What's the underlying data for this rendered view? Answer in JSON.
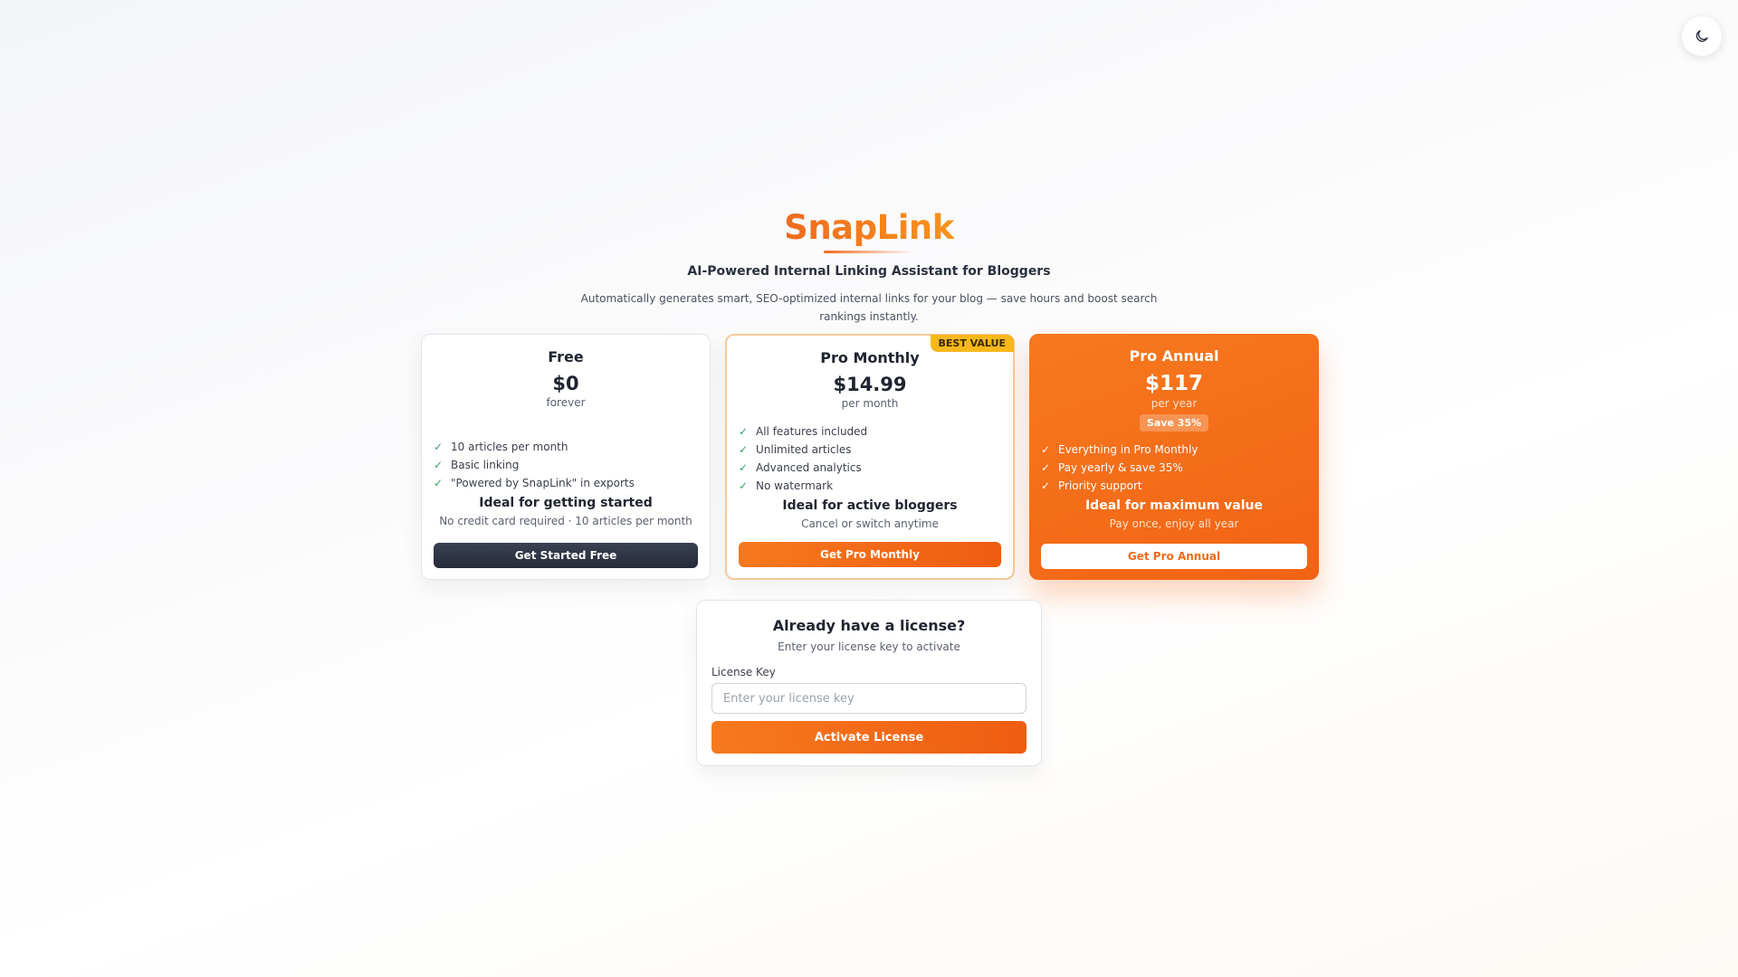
{
  "header": {
    "theme_toggle_icon": "moon-icon"
  },
  "hero": {
    "brand": "SnapLink",
    "tagline": "AI-Powered Internal Linking Assistant for Bloggers",
    "description": "Automatically generates smart, SEO-optimized internal links for your blog — save hours and boost search rankings instantly."
  },
  "plans": {
    "free": {
      "name": "Free",
      "price": "$0",
      "period": "forever",
      "features": [
        "10 articles per month",
        "Basic linking",
        "\"Powered by SnapLink\" in exports"
      ],
      "ideal": "Ideal for getting started",
      "sub": "No credit card required · 10 articles per month",
      "button": "Get Started Free"
    },
    "monthly": {
      "badge": "BEST VALUE",
      "name": "Pro Monthly",
      "price": "$14.99",
      "period": "per month",
      "features": [
        "All features included",
        "Unlimited articles",
        "Advanced analytics",
        "No watermark"
      ],
      "ideal": "Ideal for active bloggers",
      "sub": "Cancel or switch anytime",
      "button": "Get Pro Monthly"
    },
    "annual": {
      "name": "Pro Annual",
      "price": "$117",
      "period": "per year",
      "save": "Save 35%",
      "features": [
        "Everything in Pro Monthly",
        "Pay yearly & save 35%",
        "Priority support"
      ],
      "ideal": "Ideal for maximum value",
      "sub": "Pay once, enjoy all year",
      "button": "Get Pro Annual"
    }
  },
  "license": {
    "title": "Already have a license?",
    "subtitle": "Enter your license key to activate",
    "label": "License Key",
    "placeholder": "Enter your license key",
    "value": "",
    "button": "Activate License"
  },
  "colors": {
    "accent": "#f16315",
    "badge": "#f6b81c",
    "check": "#2fa86a"
  }
}
